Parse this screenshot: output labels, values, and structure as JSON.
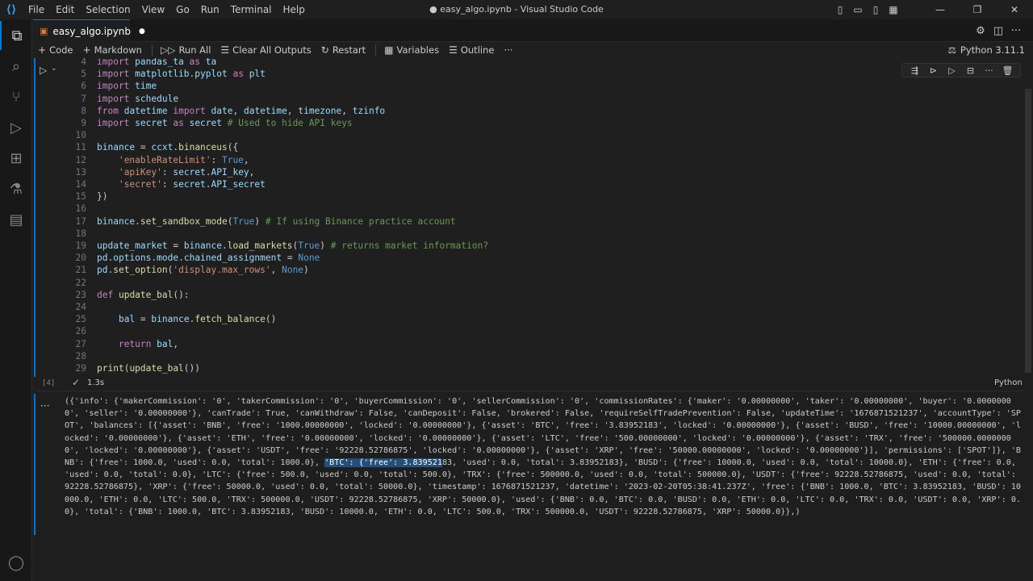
{
  "window": {
    "title": "● easy_algo.ipynb - Visual Studio Code",
    "menu": [
      "File",
      "Edit",
      "Selection",
      "View",
      "Go",
      "Run",
      "Terminal",
      "Help"
    ]
  },
  "tab": {
    "name": "easy_algo.ipynb",
    "modified_dot": "●"
  },
  "toolbar": {
    "code": "Code",
    "markdown": "Markdown",
    "run_all": "Run All",
    "clear_outputs": "Clear All Outputs",
    "restart": "Restart",
    "variables": "Variables",
    "outline": "Outline",
    "more": "···",
    "kernel": "Python 3.11.1"
  },
  "cell": {
    "exec_count": "[4]",
    "exec_time": "1.3s",
    "language": "Python",
    "lines": [
      {
        "n": "4",
        "text": "import pandas_ta as ta"
      },
      {
        "n": "5",
        "text": "import matplotlib.pyplot as plt"
      },
      {
        "n": "6",
        "text": "import time"
      },
      {
        "n": "7",
        "text": "import schedule"
      },
      {
        "n": "8",
        "text": "from datetime import date, datetime, timezone, tzinfo"
      },
      {
        "n": "9",
        "text": "import secret as secret # Used to hide API keys"
      },
      {
        "n": "10",
        "text": ""
      },
      {
        "n": "11",
        "text": "binance = ccxt.binanceus({"
      },
      {
        "n": "12",
        "text": "    'enableRateLimit': True,"
      },
      {
        "n": "13",
        "text": "    'apiKey': secret.API_key,"
      },
      {
        "n": "14",
        "text": "    'secret': secret.API_secret"
      },
      {
        "n": "15",
        "text": "})"
      },
      {
        "n": "16",
        "text": ""
      },
      {
        "n": "17",
        "text": "binance.set_sandbox_mode(True) # If using Binance practice account"
      },
      {
        "n": "18",
        "text": ""
      },
      {
        "n": "19",
        "text": "update_market = binance.load_markets(True) # returns market information?"
      },
      {
        "n": "20",
        "text": "pd.options.mode.chained_assignment = None"
      },
      {
        "n": "21",
        "text": "pd.set_option('display.max_rows', None)"
      },
      {
        "n": "22",
        "text": ""
      },
      {
        "n": "23",
        "text": "def update_bal():"
      },
      {
        "n": "24",
        "text": ""
      },
      {
        "n": "25",
        "text": "    bal = binance.fetch_balance()"
      },
      {
        "n": "26",
        "text": ""
      },
      {
        "n": "27",
        "text": "    return bal,"
      },
      {
        "n": "28",
        "text": ""
      },
      {
        "n": "29",
        "text": "print(update_bal())"
      }
    ]
  },
  "output": {
    "before": "({'info': {'makerCommission': '0', 'takerCommission': '0', 'buyerCommission': '0', 'sellerCommission': '0', 'commissionRates': {'maker': '0.00000000', 'taker': '0.00000000', 'buyer': '0.00000000', 'seller': '0.00000000'}, 'canTrade': True, 'canWithdraw': False, 'canDeposit': False, 'brokered': False, 'requireSelfTradePrevention': False, 'updateTime': '1676871521237', 'accountType': 'SPOT', 'balances': [{'asset': 'BNB', 'free': '1000.00000000', 'locked': '0.00000000'}, {'asset': 'BTC', 'free': '3.83952183', 'locked': '0.00000000'}, {'asset': 'BUSD', 'free': '10000.00000000', 'locked': '0.00000000'}, {'asset': 'ETH', 'free': '0.00000000', 'locked': '0.00000000'}, {'asset': 'LTC', 'free': '500.00000000', 'locked': '0.00000000'}, {'asset': 'TRX', 'free': '500000.00000000', 'locked': '0.00000000'}, {'asset': 'USDT', 'free': '92228.52786875', 'locked': '0.00000000'}, {'asset': 'XRP', 'free': '50000.00000000', 'locked': '0.00000000'}], 'permissions': ['SPOT']}, 'BNB': {'free': 1000.0, 'used': 0.0, 'total': 1000.0}, ",
    "highlight": "'BTC': {'free': 3.839521",
    "after": "83, 'used': 0.0, 'total': 3.83952183}, 'BUSD': {'free': 10000.0, 'used': 0.0, 'total': 10000.0}, 'ETH': {'free': 0.0, 'used': 0.0, 'total': 0.0}, 'LTC': {'free': 500.0, 'used': 0.0, 'total': 500.0}, 'TRX': {'free': 500000.0, 'used': 0.0, 'total': 500000.0}, 'USDT': {'free': 92228.52786875, 'used': 0.0, 'total': 92228.52786875}, 'XRP': {'free': 50000.0, 'used': 0.0, 'total': 50000.0}, 'timestamp': 1676871521237, 'datetime': '2023-02-20T05:38:41.237Z', 'free': {'BNB': 1000.0, 'BTC': 3.83952183, 'BUSD': 10000.0, 'ETH': 0.0, 'LTC': 500.0, 'TRX': 500000.0, 'USDT': 92228.52786875, 'XRP': 50000.0}, 'used': {'BNB': 0.0, 'BTC': 0.0, 'BUSD': 0.0, 'ETH': 0.0, 'LTC': 0.0, 'TRX': 0.0, 'USDT': 0.0, 'XRP': 0.0}, 'total': {'BNB': 1000.0, 'BTC': 3.83952183, 'BUSD': 10000.0, 'ETH': 0.0, 'LTC': 500.0, 'TRX': 500000.0, 'USDT': 92228.52786875, 'XRP': 50000.0}},)"
  },
  "icons": {
    "activity": [
      "explorer-icon",
      "search-icon",
      "source-control-icon",
      "run-debug-icon",
      "extensions-icon",
      "testing-icon",
      "jupyter-icon"
    ],
    "account": "account-icon"
  },
  "colors": {
    "accent": "#0078d4",
    "keyword": "#c586c0",
    "string": "#ce9178",
    "comment": "#6a9955",
    "function": "#dcdcaa",
    "variable": "#9cdcfe",
    "constant": "#569cd6",
    "selection": "#264f78"
  }
}
